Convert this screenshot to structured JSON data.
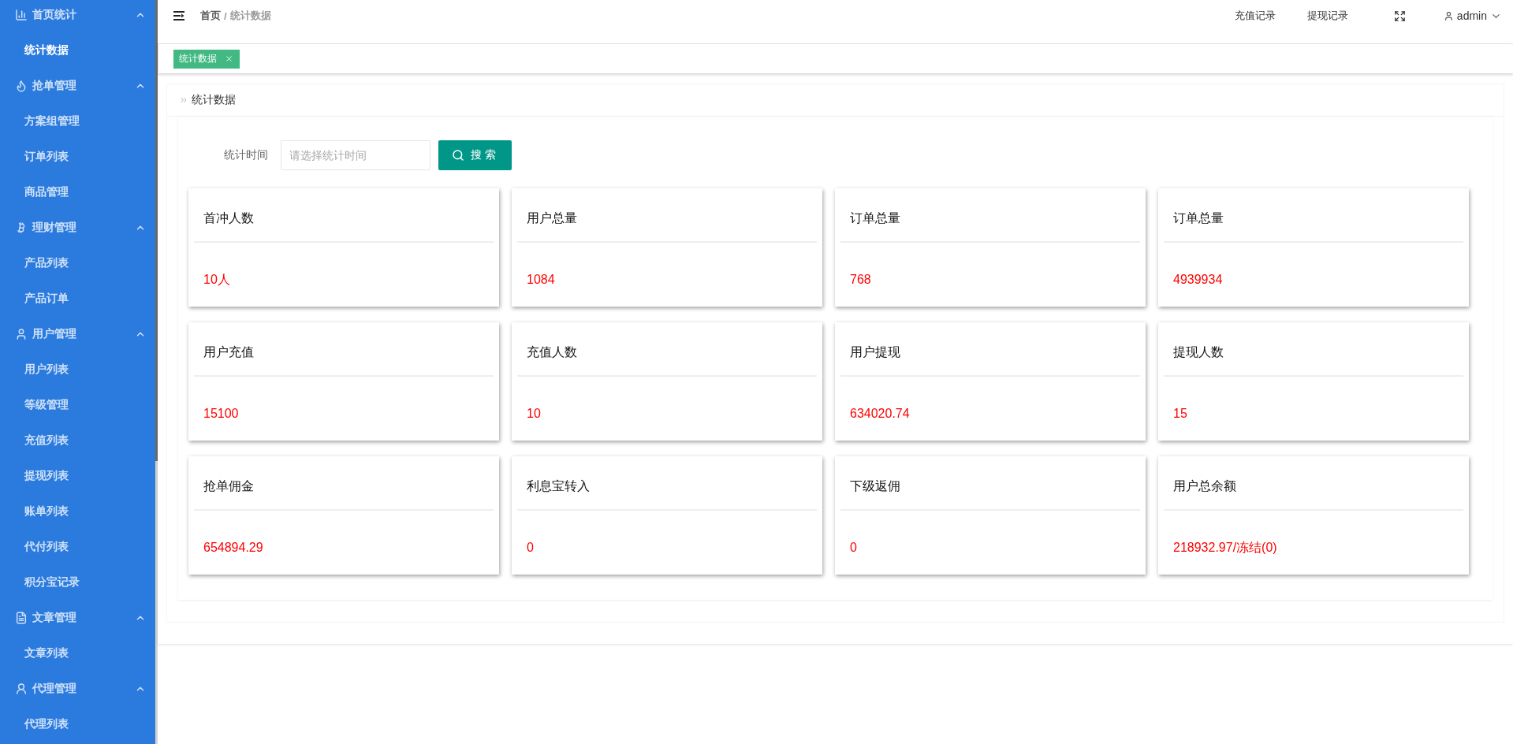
{
  "sidebar": {
    "groups": [
      {
        "label": "首页统计",
        "expanded": true,
        "items": [
          {
            "label": "统计数据",
            "selected": true
          }
        ]
      },
      {
        "label": "抢单管理",
        "expanded": true,
        "items": [
          {
            "label": "方案组管理",
            "selected": false
          },
          {
            "label": "订单列表",
            "selected": false
          },
          {
            "label": "商品管理",
            "selected": false
          }
        ]
      },
      {
        "label": "理财管理",
        "expanded": true,
        "items": [
          {
            "label": "产品列表",
            "selected": false
          },
          {
            "label": "产品订单",
            "selected": false
          }
        ]
      },
      {
        "label": "用户管理",
        "expanded": true,
        "items": [
          {
            "label": "用户列表",
            "selected": false
          },
          {
            "label": "等级管理",
            "selected": false
          },
          {
            "label": "充值列表",
            "selected": false
          },
          {
            "label": "提现列表",
            "selected": false
          },
          {
            "label": "账单列表",
            "selected": false
          },
          {
            "label": "代付列表",
            "selected": false
          },
          {
            "label": "积分宝记录",
            "selected": false
          }
        ]
      },
      {
        "label": "文章管理",
        "expanded": true,
        "items": [
          {
            "label": "文章列表",
            "selected": false
          }
        ]
      },
      {
        "label": "代理管理",
        "expanded": true,
        "items": [
          {
            "label": "代理列表",
            "selected": false
          }
        ]
      }
    ]
  },
  "header": {
    "breadcrumb": [
      "首页",
      "统计数据"
    ],
    "separator": "/",
    "links": [
      "充值记录",
      "提现记录"
    ],
    "user": "admin"
  },
  "tabs": [
    {
      "label": "统计数据",
      "selected": true
    }
  ],
  "panel": {
    "title": "统计数据",
    "search": {
      "label": "统计时间",
      "placeholder": "请选择统计时间",
      "button": "搜索"
    },
    "stats": [
      {
        "label": "首冲人数",
        "value": "10人"
      },
      {
        "label": "用户总量",
        "value": "1084"
      },
      {
        "label": "订单总量",
        "value": "768"
      },
      {
        "label": "订单总量",
        "value": "4939934"
      },
      {
        "label": "用户充值",
        "value": "15100"
      },
      {
        "label": "充值人数",
        "value": "10"
      },
      {
        "label": "用户提现",
        "value": "634020.74"
      },
      {
        "label": "提现人数",
        "value": "15"
      },
      {
        "label": "抢单佣金",
        "value": "654894.29"
      },
      {
        "label": "利息宝转入",
        "value": "0"
      },
      {
        "label": "下级返佣",
        "value": "0"
      },
      {
        "label": "用户总余额",
        "value": "218932.97/冻结(0)"
      }
    ]
  }
}
